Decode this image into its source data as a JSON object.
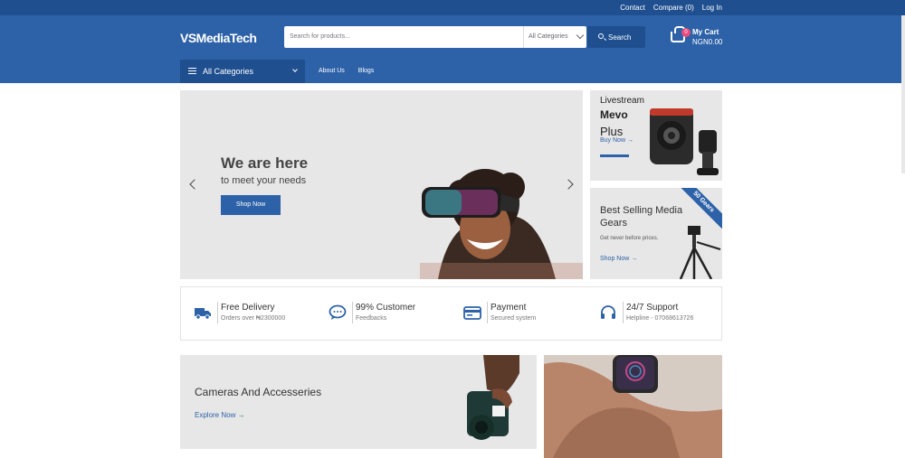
{
  "topbar": {
    "links": [
      "Contact",
      "Compare (0)",
      "Log In"
    ]
  },
  "header": {
    "logo": "VSMediaTech",
    "search_placeholder": "Search for products...",
    "category_select": "All Categories",
    "search_button": "Search",
    "cart_badge": "0",
    "cart_title": "My Cart",
    "cart_total": "NGN0.00"
  },
  "nav": {
    "categories_label": "All Categories",
    "links": [
      "About Us",
      "Blogs"
    ]
  },
  "hero": {
    "title": "We are here",
    "subtitle": "to meet your needs",
    "button": "Shop Now"
  },
  "ad1": {
    "line1": "Livestream",
    "line2": "Mevo",
    "line3": "Plus",
    "cta": "Buy Now →"
  },
  "ad2": {
    "title": "Best Selling Media Gears",
    "subtitle": "Get never before prices.",
    "cta": "Shop Now →",
    "ribbon": "50 Gears"
  },
  "features": [
    {
      "title": "Free Delivery",
      "sub": "Orders over ₦2300000",
      "icon": "truck-icon"
    },
    {
      "title": "99% Customer",
      "sub": "Feedbacks",
      "icon": "chat-icon"
    },
    {
      "title": "Payment",
      "sub": "Secured system",
      "icon": "card-icon"
    },
    {
      "title": "24/7 Support",
      "sub": "Helpline - 07068613726",
      "icon": "headset-icon"
    }
  ],
  "cameras": {
    "title": "Cameras And Accesseries",
    "cta": "Explore Now →"
  },
  "colors": {
    "primary": "#2d62a8",
    "dark": "#1f4f8f",
    "panel": "#e7e7e7"
  }
}
